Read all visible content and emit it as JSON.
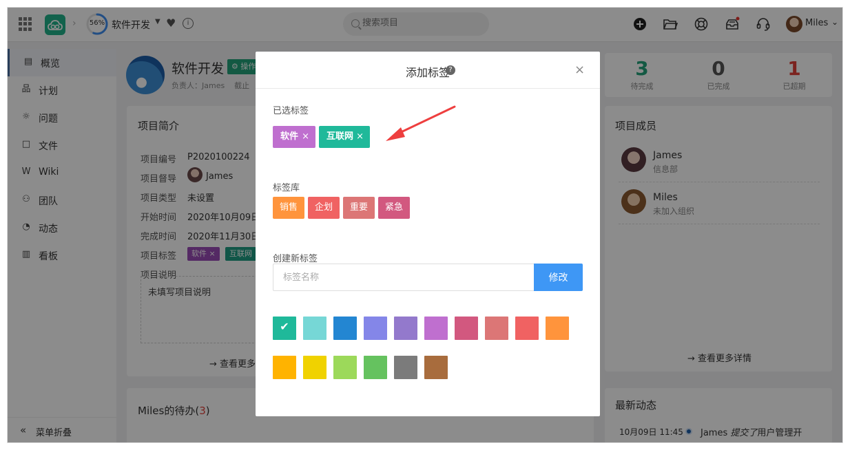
{
  "topbar": {
    "progress": "56%",
    "progress_fraction": 0.56,
    "project_name": "软件开发",
    "search_placeholder": "搜索项目",
    "user_name": "Miles"
  },
  "sidebar": {
    "items": [
      {
        "label": "概览",
        "icon": "overview-icon",
        "glyph": "▤"
      },
      {
        "label": "计划",
        "icon": "plan-icon",
        "glyph": "品"
      },
      {
        "label": "问题",
        "icon": "bug-icon",
        "glyph": "☼"
      },
      {
        "label": "文件",
        "icon": "folder-icon",
        "glyph": "□"
      },
      {
        "label": "Wiki",
        "icon": "wiki-icon",
        "glyph": "W"
      },
      {
        "label": "团队",
        "icon": "team-icon",
        "glyph": "⚇"
      },
      {
        "label": "动态",
        "icon": "activity-icon",
        "glyph": "◔"
      },
      {
        "label": "看板",
        "icon": "board-icon",
        "glyph": "▥"
      }
    ],
    "collapse_label": "菜单折叠"
  },
  "project": {
    "title": "软件开发",
    "ops_badge": "操作",
    "owner_line": "负责人：James    截止",
    "intro_title": "项目简介",
    "fields": [
      {
        "key": "项目编号",
        "value": "P2020100224"
      },
      {
        "key": "项目督导",
        "value": "James"
      },
      {
        "key": "项目类型",
        "value": "未设置"
      },
      {
        "key": "开始时间",
        "value": "2020年10月09日"
      },
      {
        "key": "完成时间",
        "value": "2020年11月30日"
      },
      {
        "key": "项目标签",
        "value": ""
      },
      {
        "key": "项目说明",
        "value": ""
      }
    ],
    "tags": [
      "软件 ×",
      "互联网"
    ],
    "description": "未填写项目说明",
    "more_link": "→ 查看更多",
    "todo_title_prefix": "Miles的待办(",
    "todo_count": "3",
    "todo_title_suffix": ")"
  },
  "stats": [
    {
      "value": "3",
      "label": "待完成",
      "color": "#23a27a"
    },
    {
      "value": "0",
      "label": "已完成",
      "color": "#555555"
    },
    {
      "value": "1",
      "label": "已超期",
      "color": "#e0403a"
    }
  ],
  "members": {
    "title": "项目成员",
    "list": [
      {
        "name": "James",
        "dept": "信息部"
      },
      {
        "name": "Miles",
        "dept": "未加入组织"
      }
    ],
    "more_link": "→ 查看更多详情"
  },
  "activity": {
    "title": "最新动态",
    "time": "10月09日 11:45",
    "actor": "James",
    "verb": "提交了",
    "object": "用户管理开"
  },
  "modal": {
    "title": "添加标签",
    "help": "?",
    "close": "×",
    "selected_label": "已选标签",
    "selected_tags": [
      {
        "name": "软件",
        "color": "#bf6fcf"
      },
      {
        "name": "互联网",
        "color": "#1fb99a"
      }
    ],
    "remove_glyph": "×",
    "library_label": "标签库",
    "library_tags": [
      {
        "name": "销售",
        "color": "#ff943c"
      },
      {
        "name": "企划",
        "color": "#f06262"
      },
      {
        "name": "重要",
        "color": "#dc7676"
      },
      {
        "name": "紧急",
        "color": "#d2587f"
      }
    ],
    "create_label": "创建新标签",
    "name_placeholder": "标签名称",
    "modify_button": "修改",
    "selected_swatch": 0,
    "check_glyph": "✔",
    "swatches": [
      "#1fb99a",
      "#76d7d6",
      "#2386d2",
      "#8486e8",
      "#9379cc",
      "#bf6fcf",
      "#d2587f",
      "#dc7676",
      "#f06262",
      "#ff943c",
      "#ffb300",
      "#f0d200",
      "#9cd95a",
      "#65c25f",
      "#7b7b7b",
      "#a86c3d"
    ]
  },
  "colors": {
    "accent": "#23a27a",
    "primary_button": "#3e97f5",
    "annotation_arrow": "#ee3f3f"
  }
}
